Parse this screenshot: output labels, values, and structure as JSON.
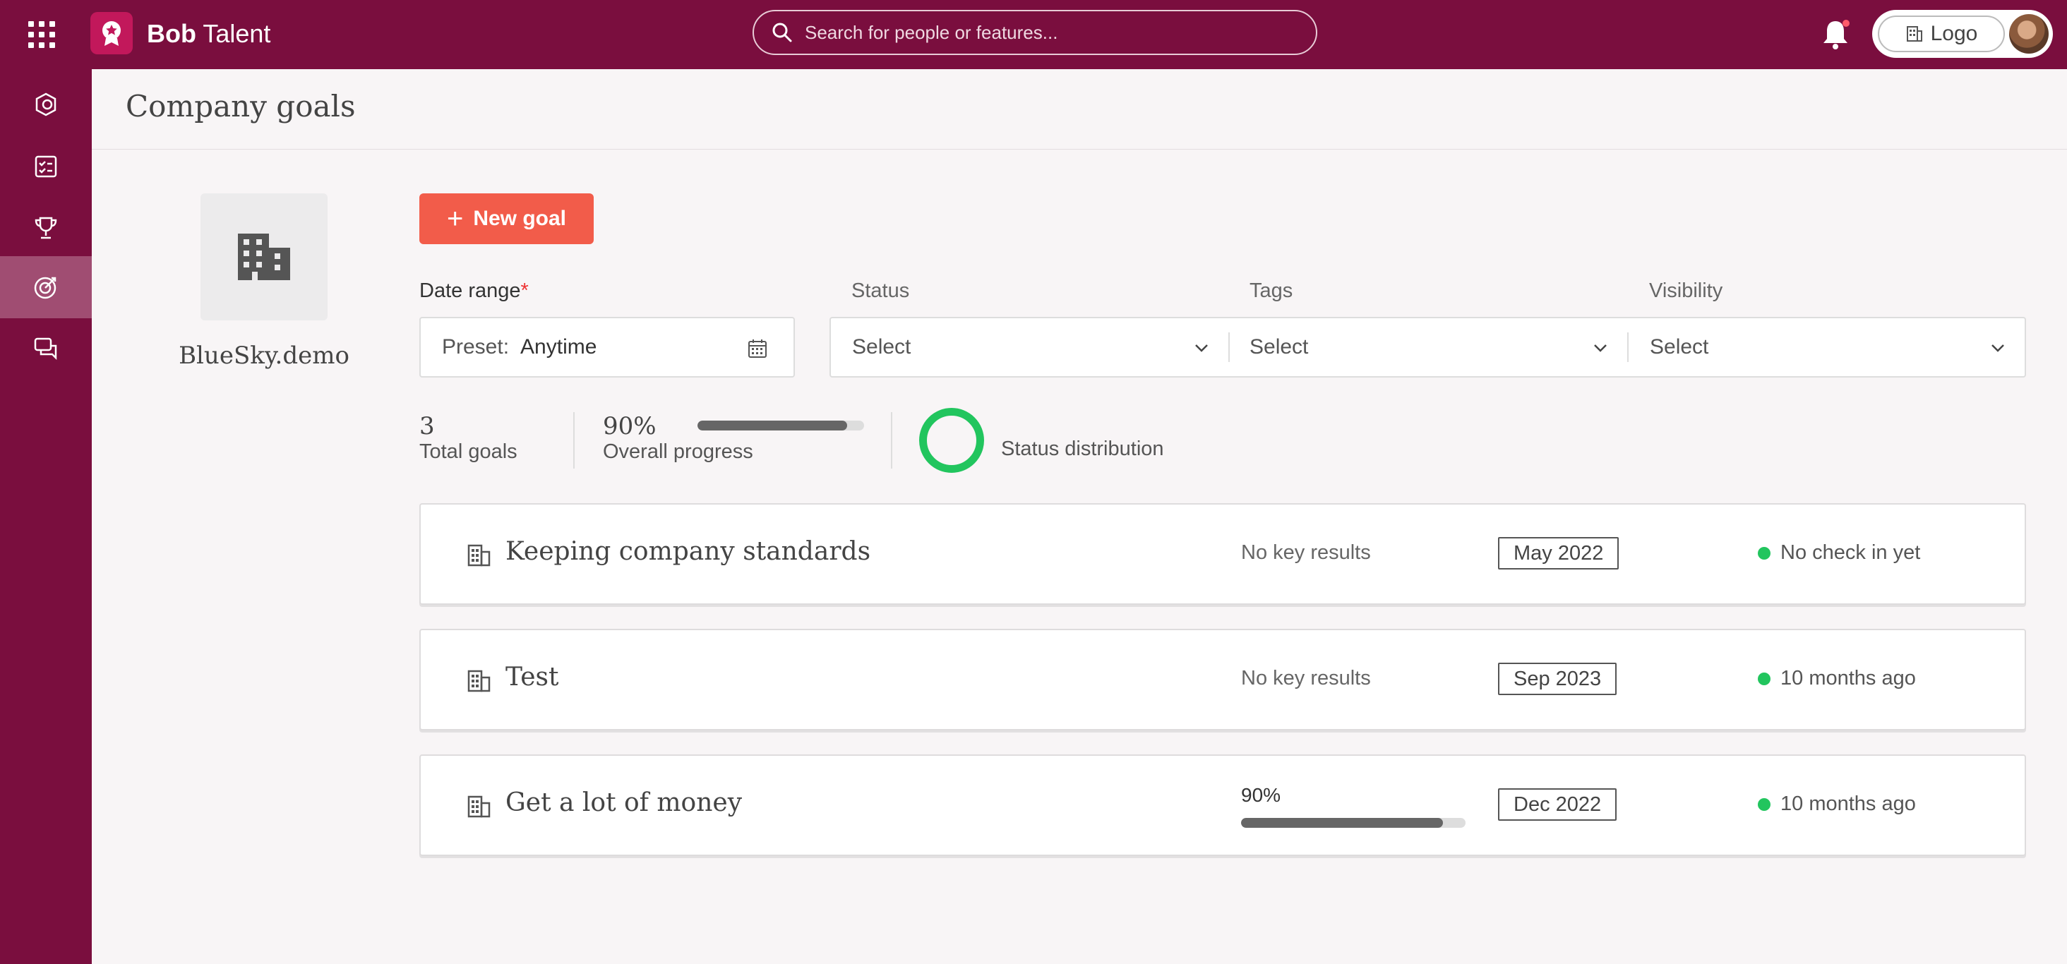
{
  "app": {
    "name_bold": "Bob",
    "name_rest": " Talent"
  },
  "search": {
    "placeholder": "Search for people or features..."
  },
  "header": {
    "company_button": "Logo"
  },
  "page": {
    "title": "Company goals"
  },
  "org": {
    "name": "BlueSky.demo"
  },
  "actions": {
    "new_goal": "New goal"
  },
  "filters": {
    "date_range": {
      "label": "Date range",
      "required_mark": "*",
      "preset_label": "Preset:",
      "value": "Anytime"
    },
    "status": {
      "label": "Status",
      "value": "Select"
    },
    "tags": {
      "label": "Tags",
      "value": "Select"
    },
    "visibility": {
      "label": "Visibility",
      "value": "Select"
    }
  },
  "stats": {
    "total_goals": {
      "value": "3",
      "label": "Total goals"
    },
    "overall_progress": {
      "value": "90%",
      "label": "Overall progress",
      "fraction": 0.9
    },
    "status_distribution": {
      "label": "Status distribution",
      "color": "#22c55e"
    }
  },
  "goals": [
    {
      "title": "Keeping company standards",
      "key_results": "No key results",
      "date": "May 2022",
      "status": "No check in yet"
    },
    {
      "title": "Test",
      "key_results": "No key results",
      "date": "Sep 2023",
      "status": "10 months ago"
    },
    {
      "title": "Get a lot of money",
      "progress": "90%",
      "progress_fraction": 0.9,
      "date": "Dec 2022",
      "status": "10 months ago"
    }
  ],
  "colors": {
    "brand": "#7a0e3e",
    "accent_button": "#f25c4a",
    "status_green": "#22c55e"
  },
  "sidebar": {
    "items": [
      {
        "icon": "badge-icon"
      },
      {
        "icon": "checklist-icon"
      },
      {
        "icon": "trophy-icon"
      },
      {
        "icon": "target-icon",
        "active": true
      },
      {
        "icon": "chat-icon"
      }
    ]
  }
}
